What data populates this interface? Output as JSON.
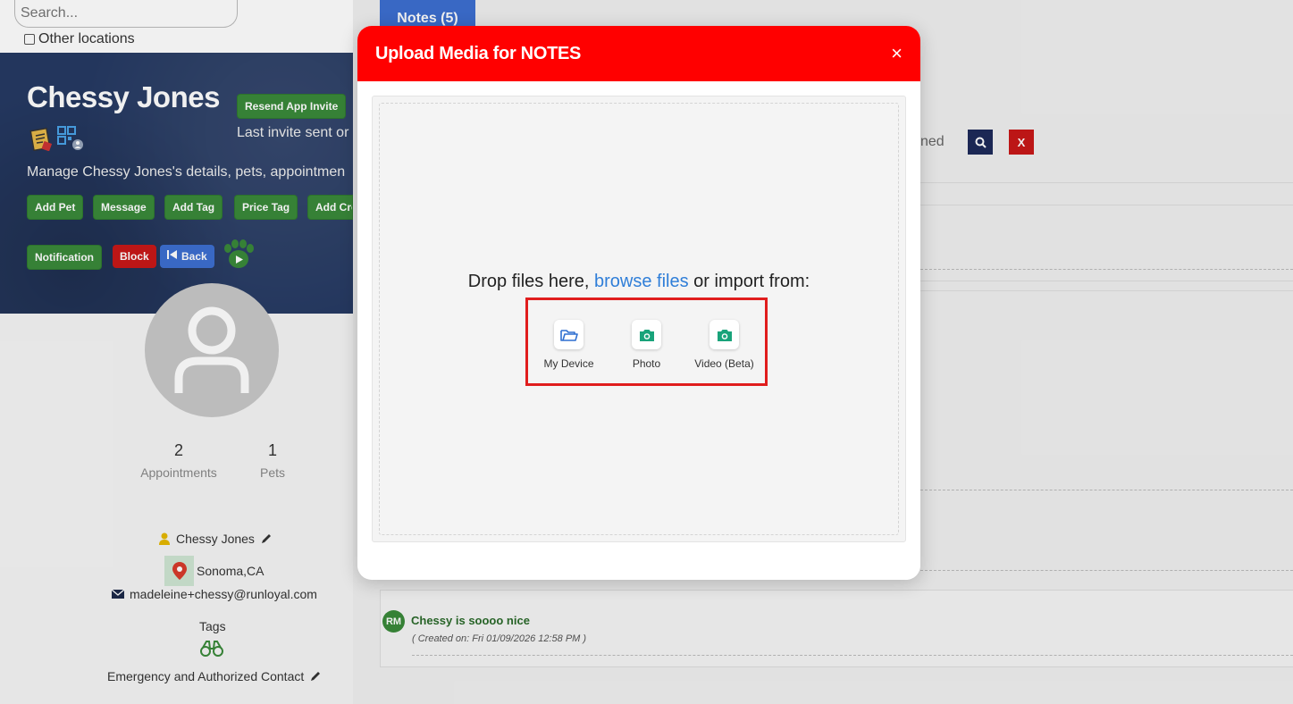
{
  "search": {
    "placeholder": "Search..."
  },
  "other_locations_label": "Other locations",
  "customer": {
    "name": "Chessy Jones",
    "resend_invite_label": "Resend App Invite",
    "last_invite_text": "Last invite sent or",
    "manage_text": "Manage Chessy Jones's details, pets, appointmen",
    "actions": {
      "add_pet": "Add Pet",
      "message": "Message",
      "add_tag": "Add Tag",
      "price_tag": "Price Tag",
      "add_credit": "Add Cre",
      "notification": "Notification",
      "block": "Block",
      "back": "Back"
    },
    "stats": {
      "appointments_count": "2",
      "appointments_label": "Appointments",
      "pets_count": "1",
      "pets_label": "Pets"
    },
    "contact_name": "Chessy Jones",
    "location": "Sonoma,CA",
    "email": "madeleine+chessy@runloyal.com",
    "tags_label": "Tags",
    "emergency_label": "Emergency and Authorized Contact"
  },
  "tabs": {
    "notes": "Notes (5)"
  },
  "filter_partial_text": "ned",
  "buttons": {
    "clear_label": "X"
  },
  "note": {
    "initials": "RM",
    "text": "Chessy is soooo nice",
    "created": "( Created on: Fri 01/09/2026 12:58 PM )"
  },
  "modal": {
    "title": "Upload Media for NOTES",
    "close_label": "×",
    "drop_text_before": "Drop files here,",
    "browse_link": "browse files",
    "drop_text_after": "or import from:",
    "sources": [
      {
        "label": "My Device",
        "icon": "folder-icon"
      },
      {
        "label": "Photo",
        "icon": "camera-icon"
      },
      {
        "label": "Video (Beta)",
        "icon": "camera-icon"
      }
    ]
  },
  "colors": {
    "modal_header": "#ff0000",
    "highlight_border": "#e01d1d",
    "link": "#2f7ed8",
    "green_button": "#3a8a3a",
    "blue_button": "#3d6fd1",
    "camera_icon": "#19a37a"
  }
}
